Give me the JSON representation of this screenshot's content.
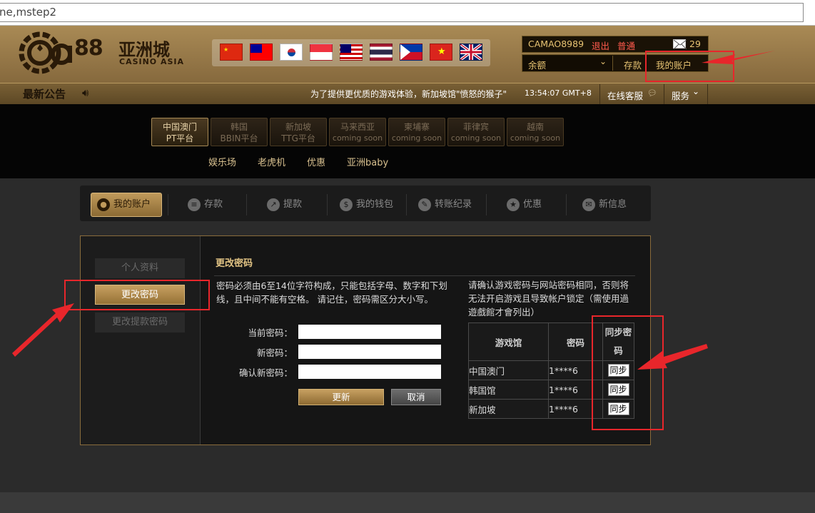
{
  "url": "ne,mstep2",
  "brand": {
    "name": "亚洲城",
    "sub": "CASINO ASIA",
    "num": "88"
  },
  "user": {
    "username": "CAMAO8989",
    "logout": "退出",
    "level": "普通",
    "messages": "29",
    "balance_label": "余额",
    "deposit": "存款",
    "my_account": "我的账户"
  },
  "notice": {
    "label": "最新公告",
    "text": "为了提供更优质的游戏体验，新加坡馆\"愤怒的猴子\"",
    "time": "13:54:07 GMT+8",
    "online_service": "在线客服",
    "service": "服务"
  },
  "platforms": [
    {
      "line1": "中国澳门",
      "line2": "PT平台"
    },
    {
      "line1": "韩国",
      "line2": "BBIN平台"
    },
    {
      "line1": "新加坡",
      "line2": "TTG平台"
    },
    {
      "line1": "马来西亚",
      "line2": "coming soon"
    },
    {
      "line1": "柬埔寨",
      "line2": "coming soon"
    },
    {
      "line1": "菲律宾",
      "line2": "coming soon"
    },
    {
      "line1": "越南",
      "line2": "coming soon"
    }
  ],
  "subnav": [
    "娱乐场",
    "老虎机",
    "优惠",
    "亚洲baby"
  ],
  "tabs": [
    "我的账户",
    "存款",
    "提款",
    "我的钱包",
    "转账纪录",
    "优惠",
    "新信息"
  ],
  "left_menu": [
    "个人资料",
    "更改密码",
    "更改提款密码"
  ],
  "page": {
    "title": "更改密码",
    "desc": "密码必须由6至14位字符构成，只能包括字母、数字和下划线，且中间不能有空格。 请记住，密码需区分大小写。",
    "current": "当前密码：",
    "new": "新密码：",
    "confirm": "确认新密码：",
    "update": "更新",
    "cancel": "取消",
    "note": "请确认游戏密码与网站密码相同，否则将无法开启游戏且导致帐户锁定（需使用過遊戲館才會列出）"
  },
  "sync_table": {
    "headers": [
      "游戏馆",
      "密码",
      "同步密码"
    ],
    "rows": [
      {
        "hall": "中国澳门",
        "pwd": "1****6",
        "btn": "同步"
      },
      {
        "hall": "韩国馆",
        "pwd": "1****6",
        "btn": "同步"
      },
      {
        "hall": "新加坡",
        "pwd": "1****6",
        "btn": "同步"
      }
    ]
  },
  "colors": {
    "gold": "#c7a061",
    "annotation": "#e8262b"
  }
}
